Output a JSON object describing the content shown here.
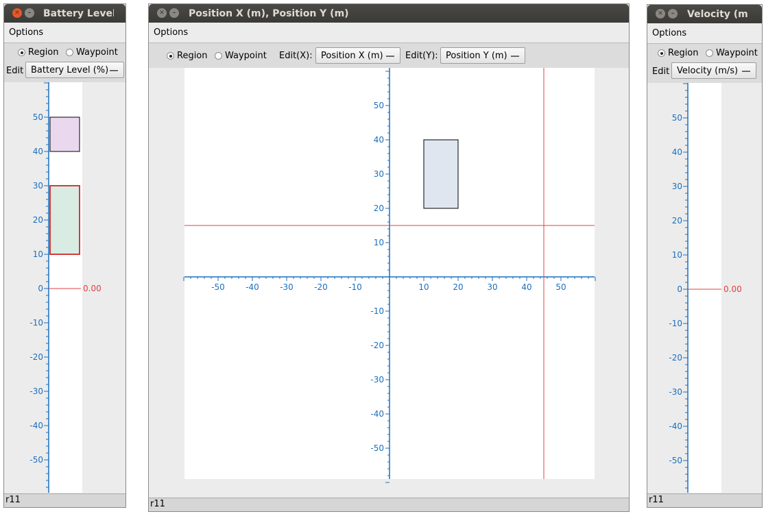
{
  "common": {
    "options_menu": "Options",
    "region_label": "Region",
    "waypoint_label": "Waypoint",
    "edit_label": "Edit",
    "status_text": "r11"
  },
  "battery_window": {
    "title": "Battery Level (%)",
    "edit_select": "Battery Level (%)",
    "marker_value": "0.00"
  },
  "position_window": {
    "title": "Position X (m), Position Y (m)",
    "edit_x_label": "Edit(X):",
    "edit_x_select": "Position X (m)",
    "edit_y_label": "Edit(Y):",
    "edit_y_select": "Position Y (m)"
  },
  "velocity_window": {
    "title": "Velocity (m/s)",
    "edit_select": "Velocity (m/s)",
    "marker_value": "0.00"
  },
  "colors": {
    "axis": "#1a6fbf",
    "marker": "#e04040",
    "region_fill": "#dfe6f0",
    "region_stroke": "#000000",
    "selected_region_stroke": "#d63a3a"
  },
  "plots": {
    "battery": {
      "axis_range": [
        -60,
        60
      ],
      "tick_labels": [
        "50",
        "40",
        "30",
        "20",
        "10",
        "0",
        "-10",
        "-20",
        "-30",
        "-40",
        "-50"
      ],
      "marker_at": 0,
      "regions": [
        {
          "min": 40,
          "max": 50,
          "selected": false,
          "tint": "#e9d8ee"
        },
        {
          "min": 10,
          "max": 30,
          "selected": true,
          "tint": "#d8ece4"
        }
      ]
    },
    "velocity": {
      "axis_range": [
        -60,
        60
      ],
      "tick_labels": [
        "50",
        "40",
        "30",
        "20",
        "10",
        "0",
        "-10",
        "-20",
        "-30",
        "-40",
        "-50"
      ],
      "marker_at": 0,
      "regions": []
    },
    "position": {
      "x_range": [
        -60,
        60
      ],
      "y_range": [
        -60,
        60
      ],
      "x_tick_labels": [
        "-50",
        "-40",
        "-30",
        "-20",
        "-10",
        "10",
        "20",
        "30",
        "40",
        "50"
      ],
      "y_tick_labels": [
        "50",
        "40",
        "30",
        "20",
        "10",
        "-10",
        "-20",
        "-30",
        "-40",
        "-50"
      ],
      "marker": {
        "x": 45,
        "y": 15
      },
      "region": {
        "x_min": 10,
        "x_max": 20,
        "y_min": 20,
        "y_max": 40,
        "tint": "#dfe6f0"
      }
    }
  }
}
